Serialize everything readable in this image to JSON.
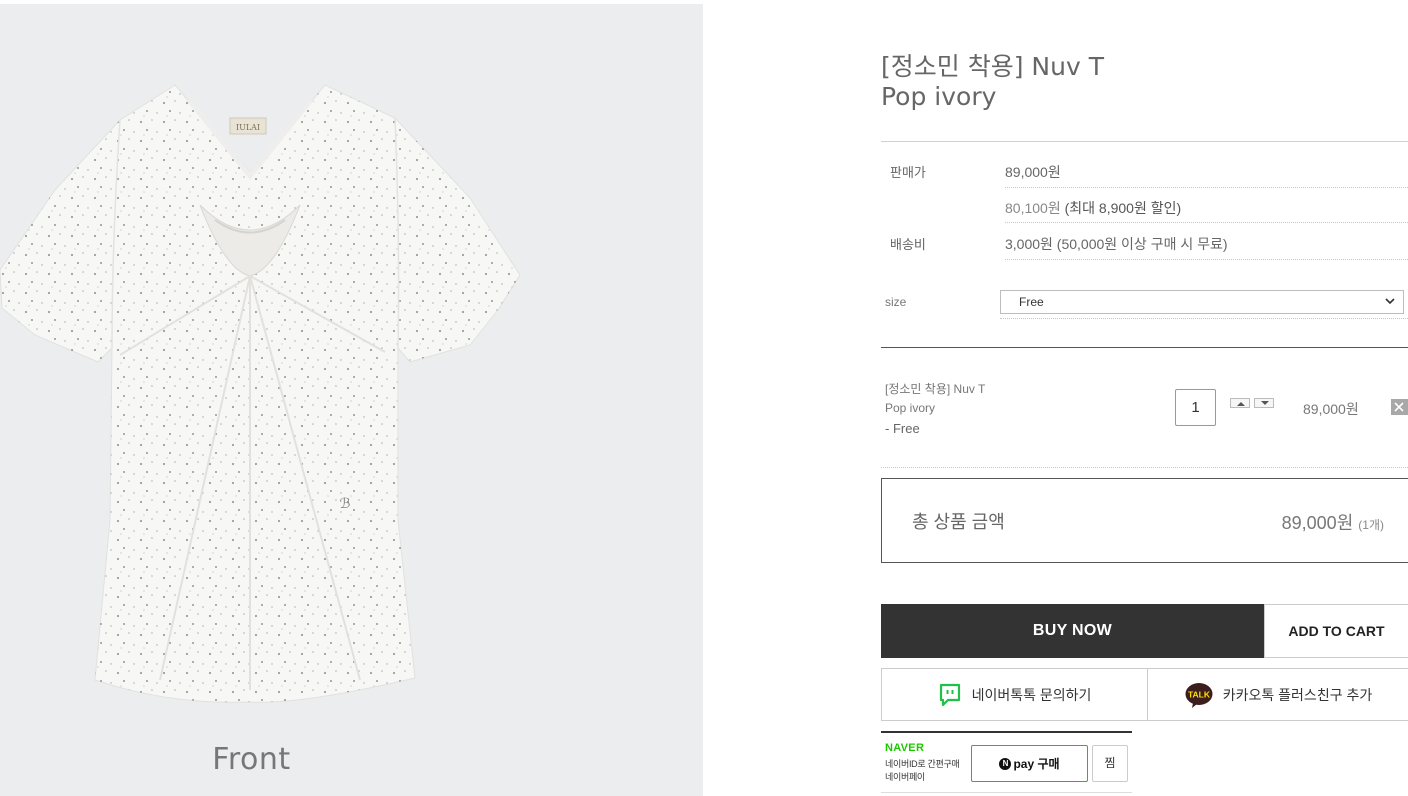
{
  "gallery": {
    "view_caption": "Front",
    "brand_tag": "IULAI"
  },
  "product": {
    "title_line1": "[정소민 착용] Nuv T",
    "title_line2": "Pop ivory"
  },
  "pricing": {
    "sale_price_label": "판매가",
    "sale_price": "89,000원",
    "discount_price": "80,100원",
    "discount_note": "(최대 8,900원 할인)",
    "shipping_label": "배송비",
    "shipping_value": "3,000원 (50,000원 이상 구매 시 무료)"
  },
  "size_option": {
    "label": "size",
    "selected": "Free"
  },
  "selected_item": {
    "name_line1": "[정소민 착용] Nuv T",
    "name_line2": "Pop ivory",
    "option": "- Free",
    "quantity": "1",
    "price": "89,000원"
  },
  "total": {
    "label": "총 상품 금액",
    "amount": "89,000원",
    "count": "(1개)"
  },
  "actions": {
    "buy_now": "BUY NOW",
    "add_to_cart": "ADD TO CART",
    "naver_talk": "네이버톡톡 문의하기",
    "kakao_talk": "카카오톡 플러스친구 추가"
  },
  "npay": {
    "brand": "NAVER",
    "sub_line1": "네이버ID로 간편구매",
    "sub_line2": "네이버페이",
    "pay_label": "pay 구매",
    "badge": "N",
    "wish_label": "찜"
  },
  "colors": {
    "dark_button": "#333333",
    "naver_green": "#1ec800",
    "kakao_yellow": "#fae100",
    "image_bg": "#ecedef"
  },
  "icons": {
    "naver_talk": "naver-talk-icon",
    "kakao_talk": "kakao-talk-icon",
    "remove": "close-icon",
    "select": "chevron-down-icon"
  }
}
